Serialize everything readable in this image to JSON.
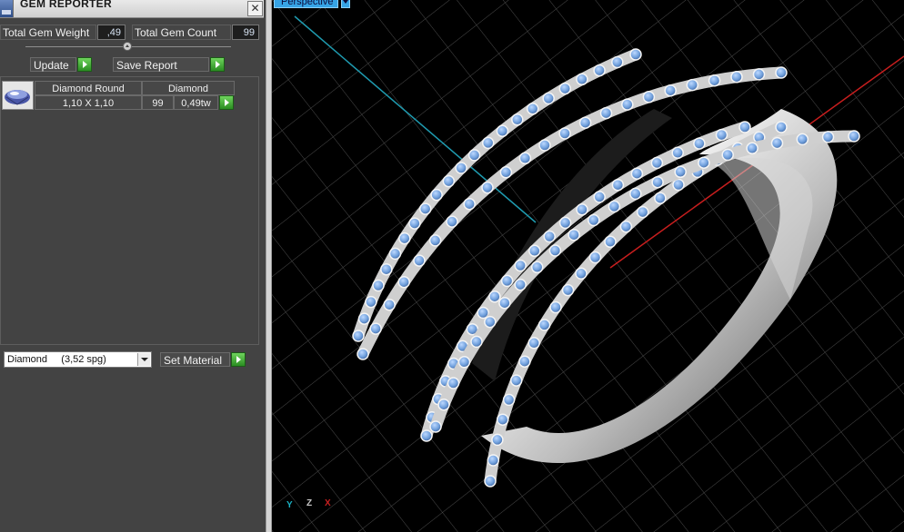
{
  "panel": {
    "title": "GEM REPORTER",
    "close": "✕",
    "total_weight_label": "Total Gem Weight",
    "total_weight_value": ",49",
    "total_count_label": "Total Gem Count",
    "total_count_value": "99",
    "update_label": "Update",
    "save_label": "Save Report"
  },
  "gem_table": {
    "name": "Diamond Round",
    "type": "Diamond",
    "size": "1,10 X 1,10",
    "count": "99",
    "weight": "0,49tw"
  },
  "material": {
    "selected": "Diamond     (3,52 spg)",
    "set_label": "Set Material"
  },
  "viewport": {
    "tab": "Perspective",
    "axis_y": "Y",
    "axis_z": "Z",
    "axis_x": "X",
    "colors": {
      "grid": "#555555",
      "axis_red": "#cc2020",
      "axis_cyan": "#20a8b8",
      "stone": "#6fa3e0",
      "metal": "#e8e8e8"
    }
  }
}
